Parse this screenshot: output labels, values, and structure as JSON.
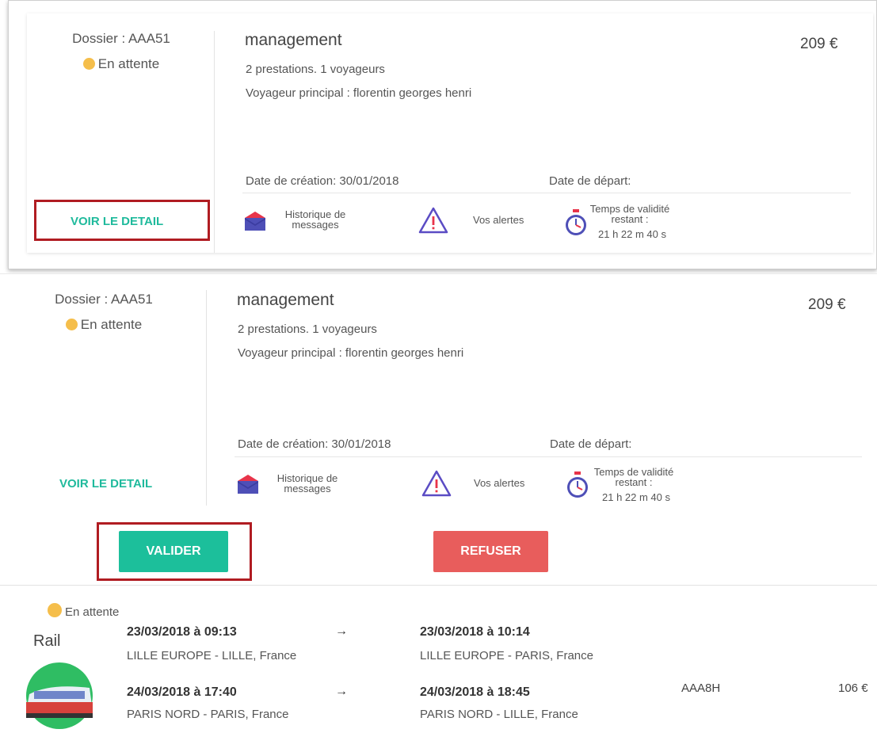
{
  "card1": {
    "dossier": "Dossier : AAA51",
    "status": "En attente",
    "title": "management",
    "prestations": "2 prestations. 1 voyageurs",
    "voyageur": "Voyageur principal : florentin georges henri",
    "price": "209 €",
    "date_creation": "Date de création: 30/01/2018",
    "date_depart": "Date de départ:",
    "voir": "VOIR LE DETAIL",
    "historique": "Historique de messages",
    "alertes": "Vos alertes",
    "validite_label": "Temps de validité restant :",
    "validite_value": "21 h 22 m 40 s"
  },
  "card2": {
    "dossier": "Dossier : AAA51",
    "status": "En attente",
    "title": "management",
    "prestations": "2 prestations. 1 voyageurs",
    "voyageur": "Voyageur principal : florentin georges henri",
    "price": "209 €",
    "date_creation": "Date de création: 30/01/2018",
    "date_depart": "Date de départ:",
    "voir": "VOIR LE DETAIL",
    "historique": "Historique de messages",
    "alertes": "Vos alertes",
    "validite_label": "Temps de validité restant :",
    "validite_value": "21 h 22 m 40 s"
  },
  "actions": {
    "valider": "VALIDER",
    "refuser": "REFUSER"
  },
  "rail": {
    "status": "En attente",
    "label": "Rail",
    "ref": "AAA8H",
    "price": "106 €",
    "segments": [
      {
        "depart_date": "23/03/2018 à 09:13",
        "depart_place": "LILLE EUROPE - LILLE, France",
        "arrow": "→",
        "arrivee_date": "23/03/2018 à 10:14",
        "arrivee_place": "LILLE EUROPE - PARIS, France"
      },
      {
        "depart_date": "24/03/2018 à 17:40",
        "depart_place": "PARIS NORD - PARIS, France",
        "arrow": "→",
        "arrivee_date": "24/03/2018 à 18:45",
        "arrivee_place": "PARIS NORD - LILLE, France"
      }
    ]
  },
  "colors": {
    "status_dot": "#f5be4b",
    "accent_green": "#1fba9c",
    "valider_bg": "#1cbf9b",
    "refuser_bg": "#e85d5c",
    "highlight_red": "#b01c22"
  },
  "icons": {
    "messages": "envelope-icon",
    "alerts": "warning-triangle-icon",
    "timer": "stopwatch-icon",
    "train": "train-icon"
  }
}
